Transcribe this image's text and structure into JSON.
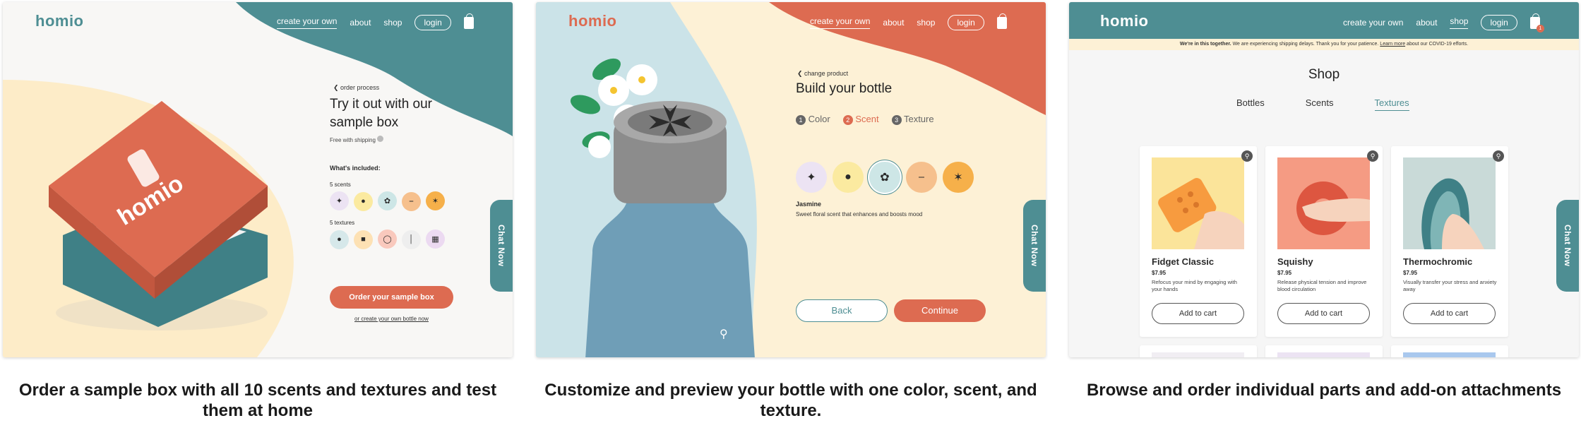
{
  "colors": {
    "teal": "#4e8e93",
    "coral": "#dd6b51",
    "cream": "#fdf1d6",
    "light_blue": "#cbe3e8"
  },
  "panel1": {
    "logo": "homio",
    "nav": {
      "create": "create your own",
      "about": "about",
      "shop": "shop",
      "login": "login"
    },
    "back_link": "order process",
    "title": "Try it out with our sample box",
    "subtitle": "Free with shipping",
    "included_label": "What's included:",
    "scents_label": "5 scents",
    "textures_label": "5 textures",
    "order_button": "Order your sample box",
    "create_link": "or create your own bottle now",
    "chat": "Chat Now",
    "box_brand": "homio",
    "caption": "Order a sample box with all 10 scents and textures and test them at home"
  },
  "panel2": {
    "logo": "homio",
    "nav": {
      "create": "create your own",
      "about": "about",
      "shop": "shop",
      "login": "login"
    },
    "back_link": "change product",
    "title": "Build your bottle",
    "steps": [
      {
        "num": "1",
        "label": "Color"
      },
      {
        "num": "2",
        "label": "Scent"
      },
      {
        "num": "3",
        "label": "Texture"
      }
    ],
    "selected_name": "Jasmine",
    "selected_desc": "Sweet floral scent that enhances and boosts mood",
    "back_button": "Back",
    "continue_button": "Continue",
    "chat": "Chat Now",
    "caption": "Customize and preview your bottle with one color, scent, and texture."
  },
  "panel3": {
    "logo": "homio",
    "nav": {
      "create": "create your own",
      "about": "about",
      "shop": "shop",
      "login": "login"
    },
    "cart_count": "1",
    "banner_bold": "We're in this together.",
    "banner_text": "We are experiencing shipping delays. Thank you for your patience.",
    "banner_link": "Learn more",
    "banner_end": "about our COVID-19 efforts.",
    "heading": "Shop",
    "tabs": [
      "Bottles",
      "Scents",
      "Textures"
    ],
    "products": [
      {
        "name": "Fidget Classic",
        "price": "$7.95",
        "desc": "Refocus your mind by engaging with your hands",
        "button": "Add to cart"
      },
      {
        "name": "Squishy",
        "price": "$7.95",
        "desc": "Release physical tension and improve blood circulation",
        "button": "Add to cart"
      },
      {
        "name": "Thermochromic",
        "price": "$7.95",
        "desc": "Visually transfer your stress and anxiety away",
        "button": "Add to cart"
      }
    ],
    "chat": "Chat Now",
    "caption": "Browse and order individual parts and add-on attachments"
  }
}
